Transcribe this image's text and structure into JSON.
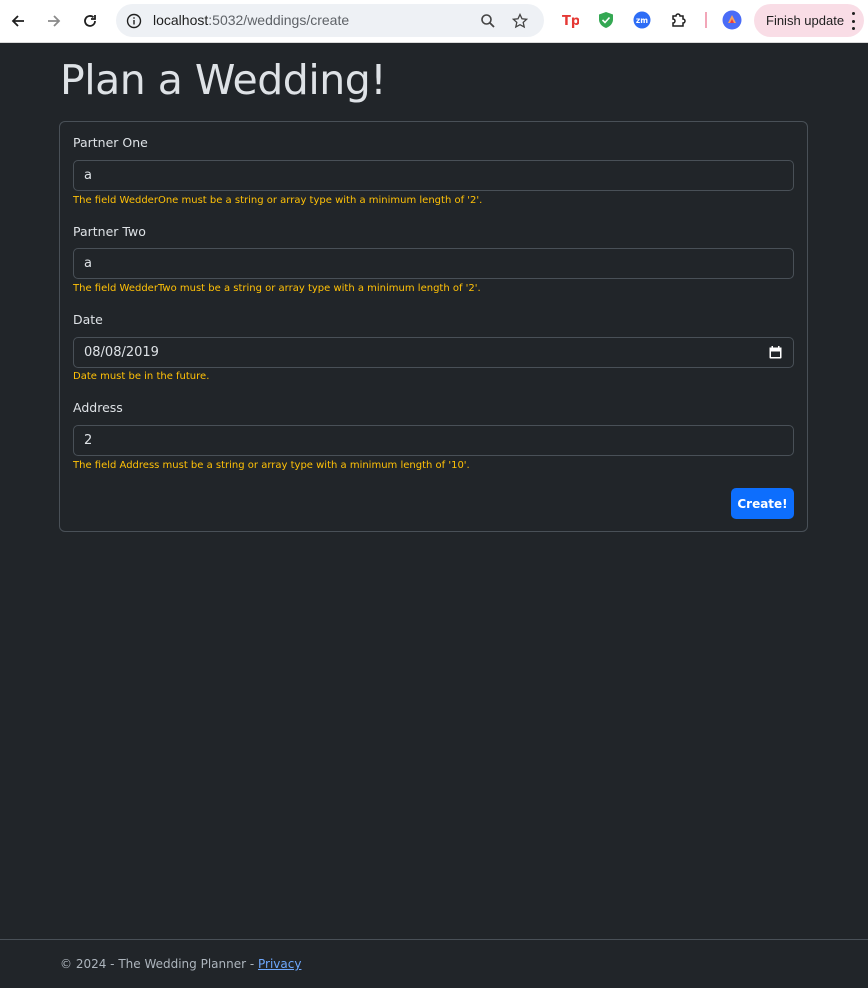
{
  "browser": {
    "url_host": "localhost",
    "url_path": ":5032/weddings/create",
    "update_button": "Finish update",
    "extension_zoom_label": "zm"
  },
  "page": {
    "title": "Plan a Wedding!"
  },
  "form": {
    "partner_one": {
      "label": "Partner One",
      "value": "a",
      "error": "The field WedderOne must be a string or array type with a minimum length of '2'."
    },
    "partner_two": {
      "label": "Partner Two",
      "value": "a",
      "error": "The field WedderTwo must be a string or array type with a minimum length of '2'."
    },
    "date": {
      "label": "Date",
      "value": "08/08/2019",
      "error": "Date must be in the future."
    },
    "address": {
      "label": "Address",
      "value": "2",
      "error": "The field Address must be a string or array type with a minimum length of '10'."
    },
    "submit_label": "Create!"
  },
  "footer": {
    "text": "© 2024 - The Wedding Planner - ",
    "privacy_link": "Privacy"
  },
  "colors": {
    "background": "#212529",
    "error": "#ffc107",
    "primary_button": "#0d6efd",
    "link": "#6ea8fe"
  }
}
